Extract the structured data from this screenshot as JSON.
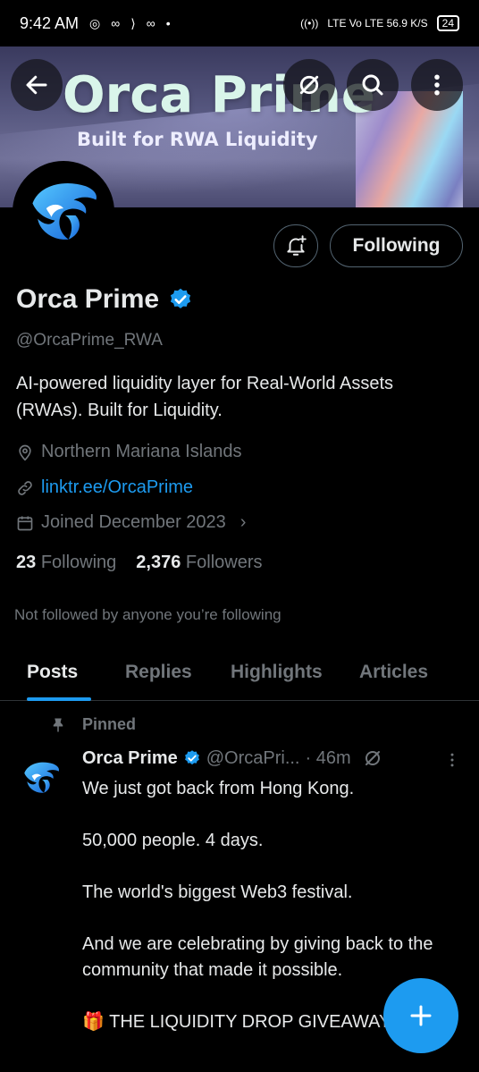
{
  "status_bar": {
    "time": "9:42 AM",
    "right_text": "LTE Vo LTE 56.9 K/S",
    "battery": "24"
  },
  "banner": {
    "logo_text": "Orca Prime",
    "tagline": "Built for RWA Liquidity"
  },
  "header_icons": [
    "back-arrow-icon",
    "grok-icon",
    "search-icon",
    "more-vertical-icon"
  ],
  "profile": {
    "name": "Orca Prime",
    "handle": "@OrcaPrime_RWA",
    "bio": "AI-powered liquidity layer for Real-World Assets (RWAs). Built for Liquidity.",
    "location": "Northern Mariana Islands",
    "link": "linktr.ee/OrcaPrime",
    "joined": "Joined December 2023",
    "following_count": "23",
    "following_label": "Following",
    "followers_count": "2,376",
    "followers_label": "Followers",
    "not_followed": "Not followed by anyone you’re following",
    "follow_button": "Following"
  },
  "tabs": [
    {
      "label": "Posts",
      "active": true
    },
    {
      "label": "Replies",
      "active": false
    },
    {
      "label": "Highlights",
      "active": false
    },
    {
      "label": "Articles",
      "active": false
    }
  ],
  "tweet": {
    "pinned_label": "Pinned",
    "name": "Orca Prime",
    "handle": "@OrcaPri...",
    "time": "· 46m",
    "paragraphs": [
      "We just got back from Hong Kong.",
      "50,000 people. 4 days.",
      "The world's biggest Web3 festival.",
      "And we are celebrating by giving back to the community that made it possible.",
      "🎁 THE LIQUIDITY DROP GIVEAWAY"
    ]
  },
  "colors": {
    "accent": "#1d9bf0",
    "text_primary": "#e7e9ea",
    "text_secondary": "#71767b",
    "background": "#000000"
  }
}
